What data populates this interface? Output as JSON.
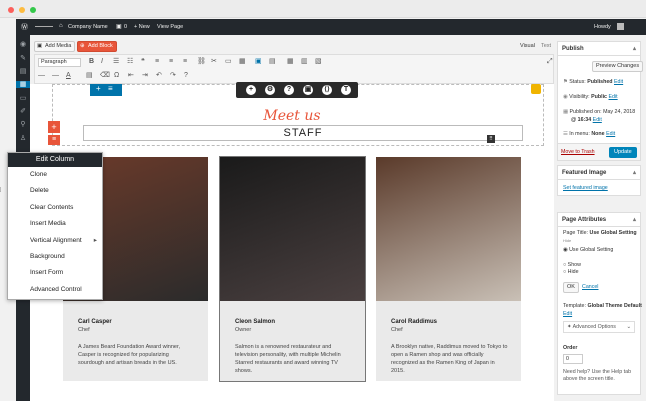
{
  "adminbar": {
    "site_name": "Company Name",
    "comments": "0",
    "new": "+ New",
    "view_page": "View Page",
    "howdy": "Howdy"
  },
  "editor": {
    "add_media": "Add Media",
    "add_block": "Add Block",
    "tab_visual": "Visual",
    "tab_text": "Text",
    "paragraph": "Paragraph"
  },
  "content": {
    "script_heading": "Meet us",
    "staff_heading": "STAFF"
  },
  "context_menu": {
    "title": "Edit Column",
    "items": [
      "Clone",
      "Delete",
      "Clear Contents",
      "Insert Media",
      "Vertical Alignment",
      "Background",
      "Insert Form",
      "Advanced Control"
    ]
  },
  "cards": [
    {
      "name": "Carl Casper",
      "role": "Chef",
      "bio": "A James Beard Foundation Award winner, Casper is recognized for popularizing sourdough and artisan breads in the US.",
      "colors": [
        "#6b3a2a",
        "#2b2b2b"
      ]
    },
    {
      "name": "Cleon Salmon",
      "role": "Owner",
      "bio": "Salmon is a renowned restaurateur and television personality, with multiple Michelin Starred restaurants and award winning TV shows.",
      "colors": [
        "#1a1a1a",
        "#4a4040"
      ]
    },
    {
      "name": "Carol Raddimus",
      "role": "Chef",
      "bio": "A Brooklyn native, Raddimus moved to Tokyo to open a Ramen shop and was officially recognized as the Ramen King of Japan in 2015.",
      "colors": [
        "#5a3a2a",
        "#c9c0b6"
      ]
    }
  ],
  "publish": {
    "title": "Publish",
    "preview": "Preview Changes",
    "status_label": "Status:",
    "status_value": "Published",
    "edit": "Edit",
    "visibility_label": "Visibility:",
    "visibility_value": "Public",
    "published_on": "Published on: May 24, 2018",
    "published_time": "@ 16:34",
    "in_menu_label": "In menu:",
    "in_menu_value": "None",
    "move_to_trash": "Move to Trash",
    "update": "Update"
  },
  "featured": {
    "title": "Featured Image",
    "link": "Set featured image"
  },
  "attributes": {
    "title": "Page Attributes",
    "page_title_label": "Page Title:",
    "page_title_value": "Use Global Setting",
    "hide_label": "Hide",
    "opt_global": "Use Global Setting",
    "opt_show": "Show",
    "opt_hide": "Hide",
    "ok": "OK",
    "cancel": "Cancel",
    "template_label": "Template:",
    "template_value": "Global Theme Default",
    "advanced": "Advanced Options",
    "order_label": "Order",
    "order_value": "0",
    "help": "Need help? Use the Help tab above the screen title."
  }
}
